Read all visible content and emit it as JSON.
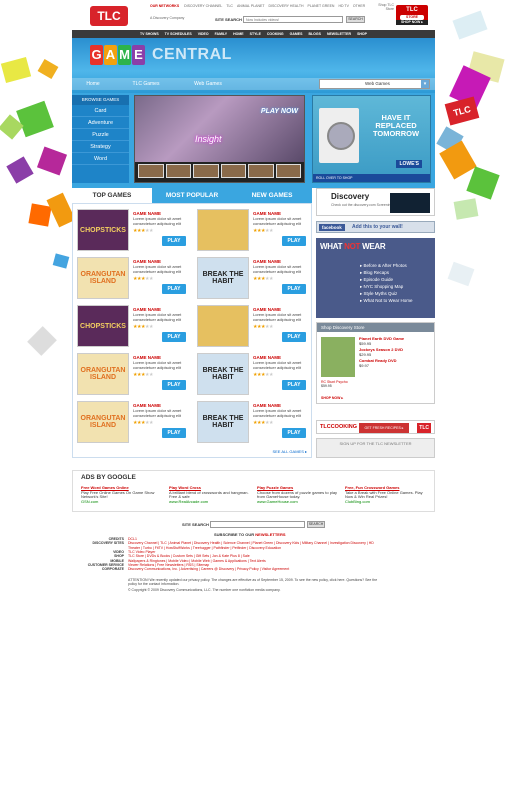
{
  "header": {
    "logo": "TLC",
    "tagline": "A Discovery Company",
    "networks_label": "OUR NETWORKS",
    "networks": [
      "DISCOVERY CHANNEL",
      "TLC",
      "ANIMAL PLANET",
      "DISCOVERY HEALTH",
      "PLANET GREEN",
      "HD TV",
      "OTHER"
    ],
    "search_label": "SITE SEARCH",
    "search_placeholder": "Now Includes videos!",
    "search_button": "SEARCH",
    "shop_text": "Shop TLC Store",
    "shop_logo": "TLC",
    "shop_logo_sub": "STORE",
    "shop_button": "SHOP NOW ▸"
  },
  "navbar": [
    "TV SHOWS",
    "TV SCHEDULES",
    "VIDEO",
    "FAMILY",
    "HOME",
    "STYLE",
    "COOKING",
    "GAMES",
    "BLOGS",
    "NEWSLETTER",
    "SHOP"
  ],
  "game_central": {
    "letters": [
      "G",
      "A",
      "M",
      "E"
    ],
    "letter_colors": [
      "#e8322a",
      "#f2a10f",
      "#2db34a",
      "#8b3ea8"
    ],
    "central": "CENTRAL",
    "subnav": [
      "Home",
      "TLC Games",
      "Web Games"
    ],
    "dropdown_value": "Web Games"
  },
  "browse": {
    "header": "BROWSE GAMES",
    "items": [
      "Card",
      "Adventure",
      "Puzzle",
      "Strategy",
      "Word"
    ]
  },
  "feature": {
    "play_now": "PLAY NOW",
    "title": "Insight"
  },
  "lowes_ad": {
    "headline": "HAVE IT REPLACED TOMORROW",
    "brand": "LOWE'S",
    "rollover": "ROLL OVER TO SHOP"
  },
  "tabs": [
    "TOP GAMES",
    "MOST POPULAR",
    "NEW GAMES"
  ],
  "games": [
    {
      "thumb": "CHOPSTICKS",
      "name": "GAME NAME",
      "desc": "Lorem ipsum dolor sit amet consectetuer adipiscing elit",
      "rating": 3,
      "play": "PLAY"
    },
    {
      "thumb": "",
      "name": "GAME NAME",
      "desc": "Lorem ipsum dolor sit amet consectetuer adipiscing elit",
      "rating": 3,
      "play": "PLAY"
    },
    {
      "thumb": "ORANGUTAN ISLAND",
      "name": "GAME NAME",
      "desc": "Lorem ipsum dolor sit amet consectetuer adipiscing elit",
      "rating": 3,
      "play": "PLAY"
    },
    {
      "thumb": "BREAK THE HABIT",
      "name": "GAME NAME",
      "desc": "Lorem ipsum dolor sit amet consectetuer adipiscing elit",
      "rating": 3,
      "play": "PLAY"
    },
    {
      "thumb": "CHOPSTICKS",
      "name": "GAME NAME",
      "desc": "Lorem ipsum dolor sit amet consectetuer adipiscing elit",
      "rating": 3,
      "play": "PLAY"
    },
    {
      "thumb": "",
      "name": "GAME NAME",
      "desc": "Lorem ipsum dolor sit amet consectetuer adipiscing elit",
      "rating": 3,
      "play": "PLAY"
    },
    {
      "thumb": "ORANGUTAN ISLAND",
      "name": "GAME NAME",
      "desc": "Lorem ipsum dolor sit amet consectetuer adipiscing elit",
      "rating": 3,
      "play": "PLAY"
    },
    {
      "thumb": "BREAK THE HABIT",
      "name": "GAME NAME",
      "desc": "Lorem ipsum dolor sit amet consectetuer adipiscing elit",
      "rating": 3,
      "play": "PLAY"
    },
    {
      "thumb": "ORANGUTAN ISLAND",
      "name": "GAME NAME",
      "desc": "Lorem ipsum dolor sit amet consectetuer adipiscing elit",
      "rating": 3,
      "play": "PLAY"
    },
    {
      "thumb": "BREAK THE HABIT",
      "name": "GAME NAME",
      "desc": "Lorem ipsum dolor sit amet consectetuer adipiscing elit",
      "rating": 3,
      "play": "PLAY"
    }
  ],
  "see_all": "SEE ALL GAMES ▸",
  "sidebar": {
    "discovery_logo": "Discovery",
    "discovery_text": "Check out the discovery.com Screening Room!",
    "facebook": "facebook",
    "facebook_text": "Add this to your wall!",
    "wnw_logo_a": "WHAT",
    "wnw_logo_b": "NOT",
    "wnw_logo_c": "WEAR",
    "wnw_items": [
      "Before & After Photos",
      "Blog Recaps",
      "Episode Guide",
      "NYC Shopping Map",
      "Style Myths Quiz",
      "What Not to Wear Home"
    ],
    "shop_header": "Shop Discovery Store",
    "shop_caption": "RC Stunt Psycho",
    "shop_caption_price": "$59.95",
    "shop_items": [
      {
        "name": "Planet Earth DVD Game",
        "price": "$59.95"
      },
      {
        "name": "Jockeys Season 2 DVD",
        "price": "$29.95"
      },
      {
        "name": "Combat Ready DVD",
        "price": "$9.97"
      }
    ],
    "shop_now": "SHOP NOW ▸",
    "cooking_logo": "TLCCOOKING",
    "cooking_text": "GET FRESH RECIPES ▸",
    "cooking_tlc": "TLC",
    "signup": "SIGN UP FOR THE TLC NEWSLETTER"
  },
  "ads": {
    "header": "ADS BY GOOGLE",
    "items": [
      {
        "title": "Free Word Games Online",
        "text": "Play Free Online Games On Game Show Network's Site!",
        "url": "GSN.com"
      },
      {
        "title": "Play Word Cross",
        "text": "A brilliant blend of crosswords and hangman. Free & safe",
        "url": "www.RealArcade.com"
      },
      {
        "title": "Play Puzzle Games",
        "text": "Choose from dozens of puzzle games to play from GameHouse today.",
        "url": "www.GameHouse.com"
      },
      {
        "title": "Free, Fun Crossword Games",
        "text": "Take a Break with Free Online Games. Play Now & Win Real Prizes!",
        "url": "ClubBing.com"
      }
    ]
  },
  "footer": {
    "search_label": "SITE SEARCH",
    "search_button": "SEARCH",
    "subscribe_label": "SUBSCRIBE TO OUR",
    "subscribe_link": "NEWSLETTERS",
    "links": [
      {
        "k": "CREDITS",
        "v": "DCL1"
      },
      {
        "k": "DISCOVERY SITES",
        "v": "Discovery Channel | TLC | Animal Planet | Discovery Health | Science Channel | Planet Green | Discovery Kids | Military Channel | Investigation Discovery | HD Theater | Turbo | FitTV | HowStuffWorks | Treehugger | Pathfinder | Petfinder | Discovery Education"
      },
      {
        "k": "VIDEO",
        "v": "TLC Video Player"
      },
      {
        "k": "SHOP",
        "v": "TLC Store | DVDs & Books | Custom Sets | Gift Sets | Jon & Kate Plus 8 | Sale"
      },
      {
        "k": "MOBILE",
        "v": "Wallpapers & Ringtones | Mobile Video | Mobile Web | Games & Applications | Text Alerts"
      },
      {
        "k": "CUSTOMER SERVICE",
        "v": "Viewer Relations | Free Newsletters | RSS | Sitemap"
      },
      {
        "k": "CORPORATE",
        "v": "Discovery Communications, Inc. | Advertising | Careers @ Discovery | Privacy Policy | Visitor Agreement"
      }
    ],
    "attention": "ATTENTION! We recently updated our privacy policy. The changes are effective as of September 15, 2009. To see the new policy, click here. Questions? See the policy for the contact information.",
    "copyright": "© Copyright © 2009 Discovery Communications, LLC. The number one nonfiction media company."
  }
}
